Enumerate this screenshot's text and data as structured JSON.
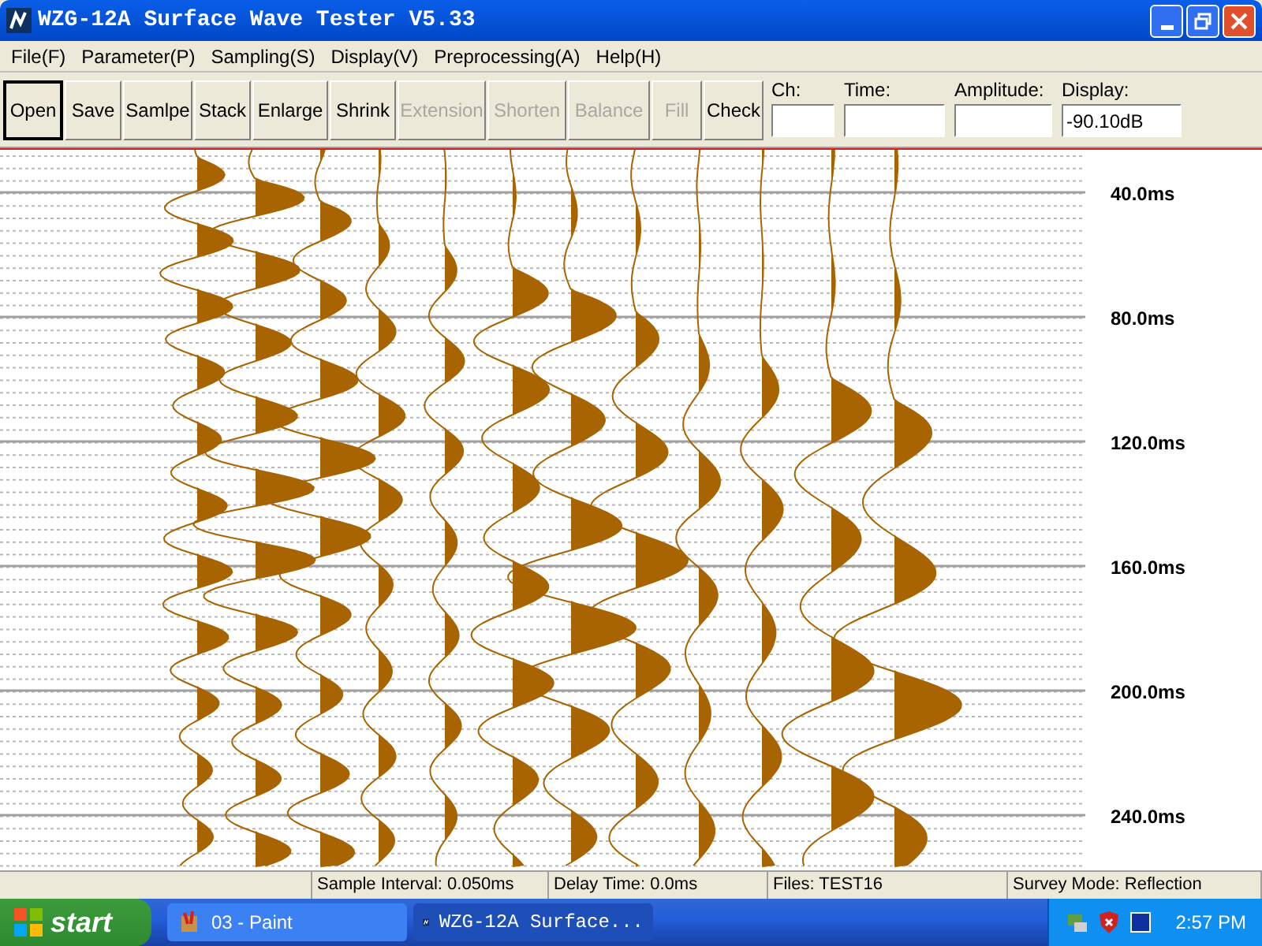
{
  "window": {
    "title": "WZG-12A Surface Wave Tester V5.33"
  },
  "menu": [
    "File(F)",
    "Parameter(P)",
    "Sampling(S)",
    "Display(V)",
    "Preprocessing(A)",
    "Help(H)"
  ],
  "toolbar": [
    {
      "label": "Open",
      "disabled": false,
      "pressed": true
    },
    {
      "label": "Save",
      "disabled": false,
      "pressed": false
    },
    {
      "label": "Samlpe",
      "disabled": false,
      "pressed": false
    },
    {
      "label": "Stack",
      "disabled": false,
      "pressed": false
    },
    {
      "label": "Enlarge",
      "disabled": false,
      "pressed": false
    },
    {
      "label": "Shrink",
      "disabled": false,
      "pressed": false
    },
    {
      "label": "Extension",
      "disabled": true,
      "pressed": false
    },
    {
      "label": "Shorten",
      "disabled": true,
      "pressed": false
    },
    {
      "label": "Balance",
      "disabled": true,
      "pressed": false
    },
    {
      "label": "Fill",
      "disabled": true,
      "pressed": false
    },
    {
      "label": "Check",
      "disabled": false,
      "pressed": false
    }
  ],
  "fields": [
    {
      "label": "Ch:"
    },
    {
      "label": "Time:"
    },
    {
      "label": "Amplitude:"
    },
    {
      "label": "Display:",
      "value": "-90.10dB"
    }
  ],
  "plot": {
    "time_labels": [
      "40.0ms",
      "80.0ms",
      "120.0ms",
      "160.0ms",
      "200.0ms",
      "240.0ms"
    ]
  },
  "status_bar": [
    "Sample Interval: 0.050ms",
    "Delay Time: 0.0ms",
    "Files: TEST16",
    "Survey Mode: Reflection"
  ],
  "taskbar": {
    "start": "start",
    "tasks": [
      {
        "label": "03 - Paint",
        "selected": false
      },
      {
        "label": "WZG-12A Surface...",
        "selected": true
      }
    ],
    "clock": "2:57 PM"
  }
}
